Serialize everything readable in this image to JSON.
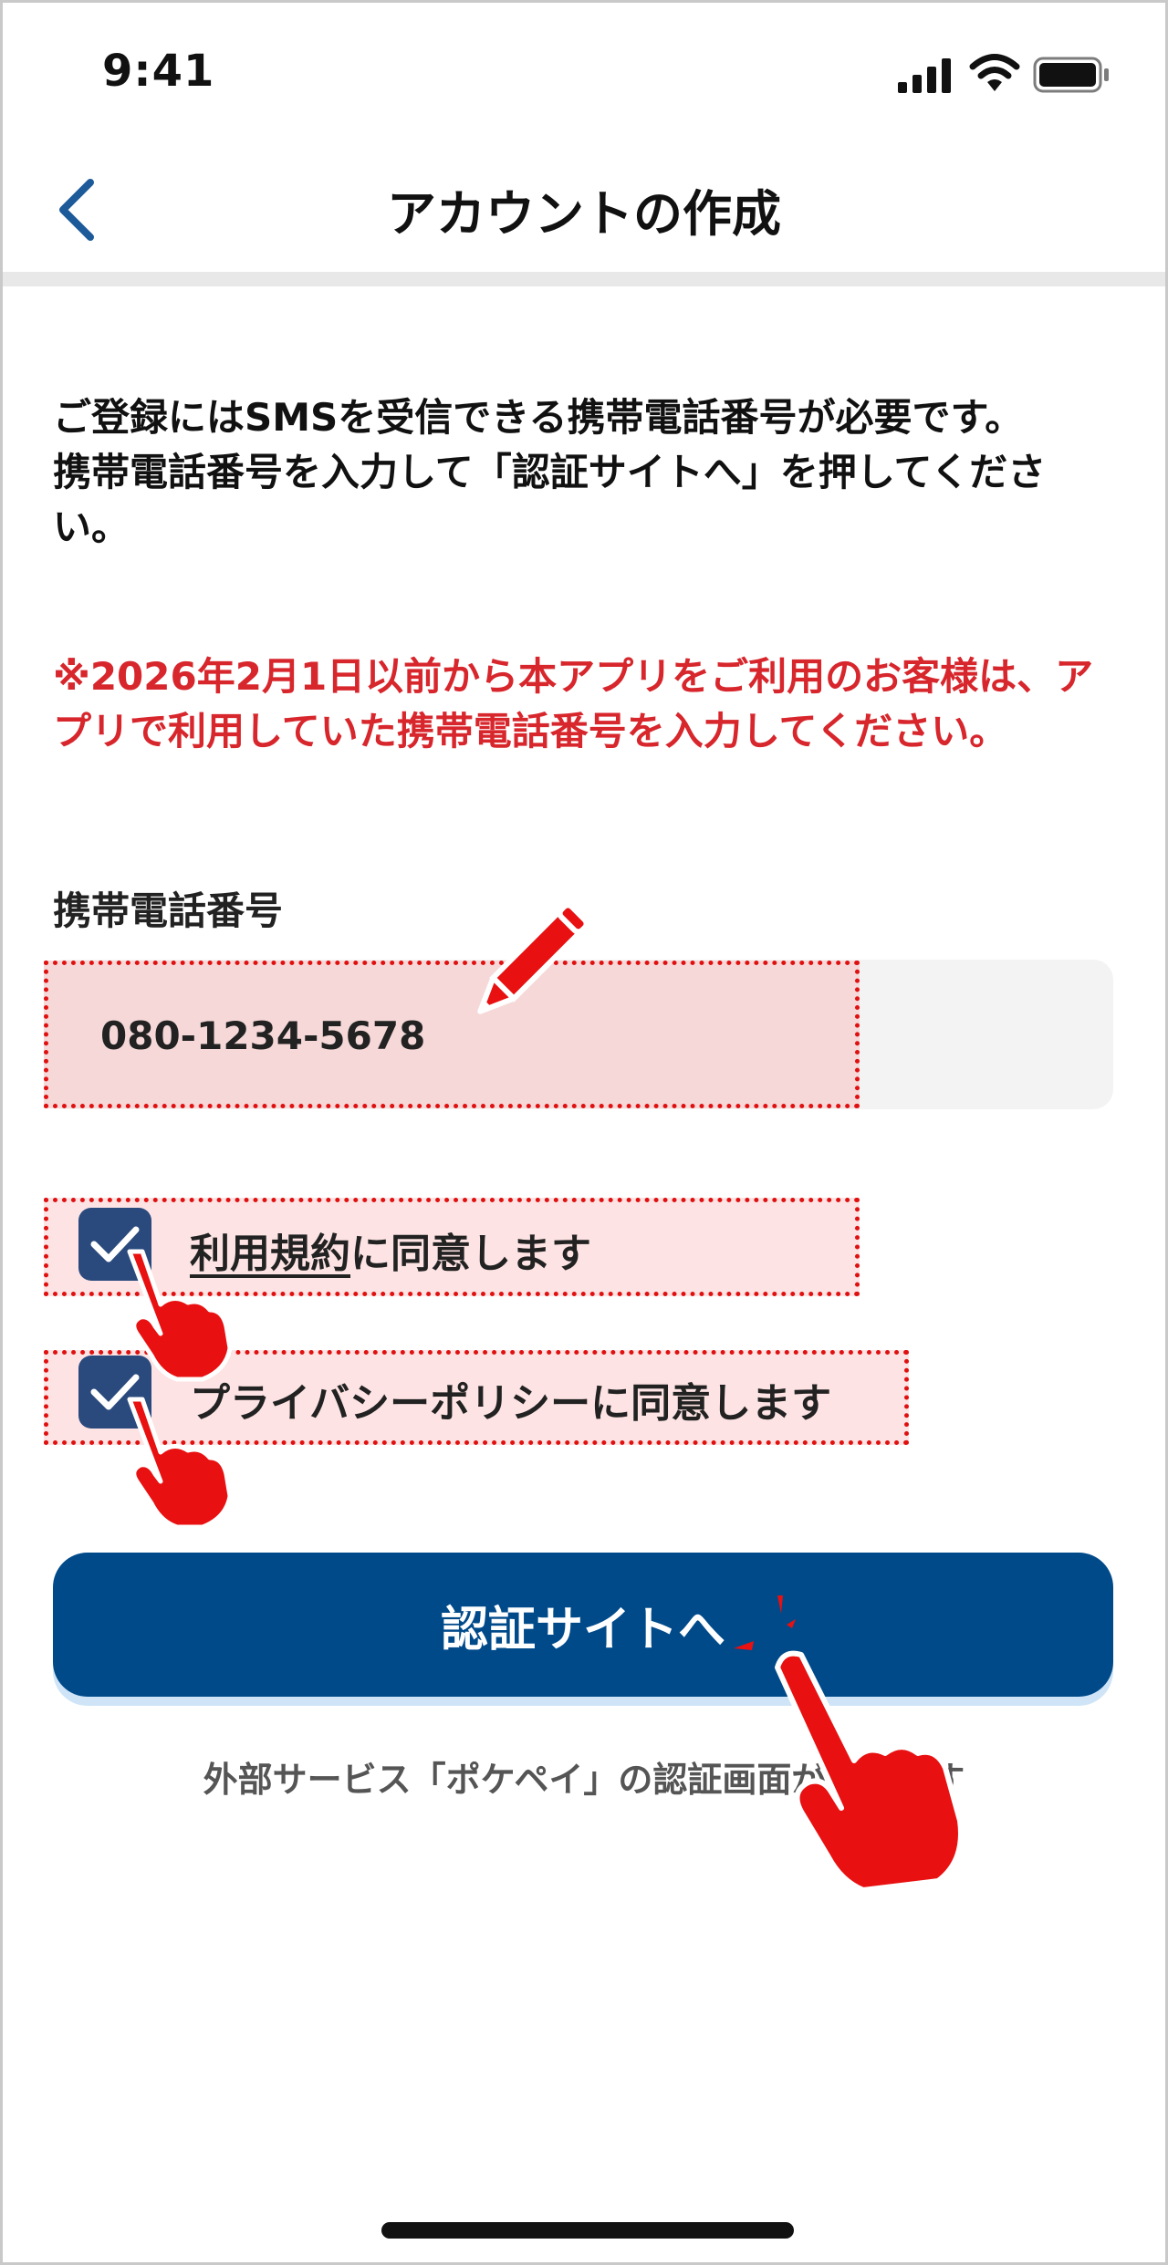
{
  "status_bar": {
    "time": "9:41"
  },
  "nav": {
    "title": "アカウントの作成"
  },
  "intro": {
    "line1": "ご登録にはSMSを受信できる携帯電話番号が必要です。",
    "line2": "携帯電話番号を入力して「認証サイトへ」を押してください。"
  },
  "notice": "※2026年2月1日以前から本アプリをご利用のお客様は、アプリで利用していた携帯電話番号を入力してください。",
  "phone": {
    "label": "携帯電話番号",
    "value": "080-1234-5678"
  },
  "agreements": {
    "terms_link": "利用規約",
    "terms_suffix": "に同意します",
    "privacy": "プライバシーポリシーに同意します"
  },
  "cta": {
    "label": "認証サイトへ",
    "note": "外部サービス「ポケペイ」の認証画面が開きます"
  },
  "colors": {
    "primary": "#004a8a",
    "warning": "#d7262c",
    "highlight": "#e01010",
    "checkbox": "#2a4a7e"
  },
  "icons": [
    "cellular-signal-icon",
    "wifi-icon",
    "battery-icon",
    "chevron-left-icon",
    "checkmark-icon",
    "pencil-icon",
    "pointing-hand-icon"
  ]
}
